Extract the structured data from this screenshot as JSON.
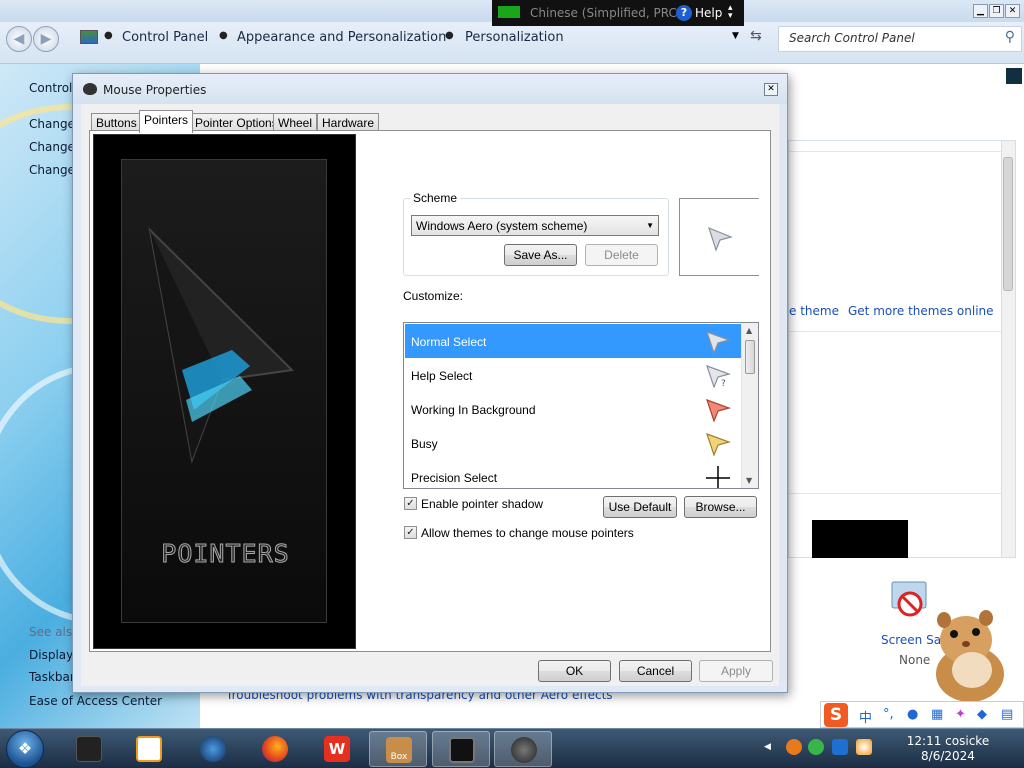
{
  "ime_bar": {
    "text": "Chinese (Simplified, PRC)",
    "help_label": "Help"
  },
  "explorer": {
    "breadcrumbs": [
      "Control Panel",
      "Appearance and Personalization",
      "Personalization"
    ],
    "search_placeholder": "Search Control Panel",
    "left_pane": {
      "title": "Control",
      "links": [
        "Change",
        "Change",
        "Change"
      ],
      "see_also": "See also",
      "see_also_links": [
        "Display",
        "Taskbar",
        "Ease of Access Center"
      ]
    },
    "content": {
      "theme_link_partial": "e theme",
      "get_more_themes": "Get more themes online",
      "screen_saver_label": "Screen Saver",
      "screen_saver_value": "None",
      "troubleshoot_link": "Troubleshoot problems with transparency and other Aero effects"
    }
  },
  "dialog": {
    "title": "Mouse Properties",
    "tabs": [
      "Buttons",
      "Pointers",
      "Pointer Options",
      "Wheel",
      "Hardware"
    ],
    "active_tab": "Pointers",
    "splash_text": "POINTERS",
    "scheme": {
      "group_label": "Scheme",
      "selected": "Windows Aero (system scheme)",
      "save_as": "Save As...",
      "delete": "Delete"
    },
    "customize_label": "Customize:",
    "cursors": [
      {
        "label": "Normal Select",
        "icon": "arrow-cursor-icon",
        "selected": true
      },
      {
        "label": "Help Select",
        "icon": "help-cursor-icon",
        "selected": false
      },
      {
        "label": "Working In Background",
        "icon": "working-cursor-icon",
        "selected": false
      },
      {
        "label": "Busy",
        "icon": "busy-cursor-icon",
        "selected": false
      },
      {
        "label": "Precision Select",
        "icon": "crosshair-cursor-icon",
        "selected": false
      }
    ],
    "enable_shadow": {
      "label": "Enable pointer shadow",
      "checked": true
    },
    "allow_themes": {
      "label": "Allow themes to change mouse pointers",
      "checked": true
    },
    "use_default": "Use Default",
    "browse": "Browse...",
    "ok": "OK",
    "cancel": "Cancel",
    "apply": "Apply"
  },
  "taskbar": {
    "items": [
      "explorer-app-icon",
      "media-player-icon",
      "globe-app-icon",
      "firefox-icon",
      "wps-office-icon",
      "box-game-icon",
      "display-settings-icon",
      "mouse-properties-icon"
    ],
    "box_label": "Box",
    "clock_time": "12:11 cosicke",
    "clock_date": "8/6/2024"
  },
  "colors": {
    "selection": "#3399ff",
    "link": "#1a4fb8"
  }
}
